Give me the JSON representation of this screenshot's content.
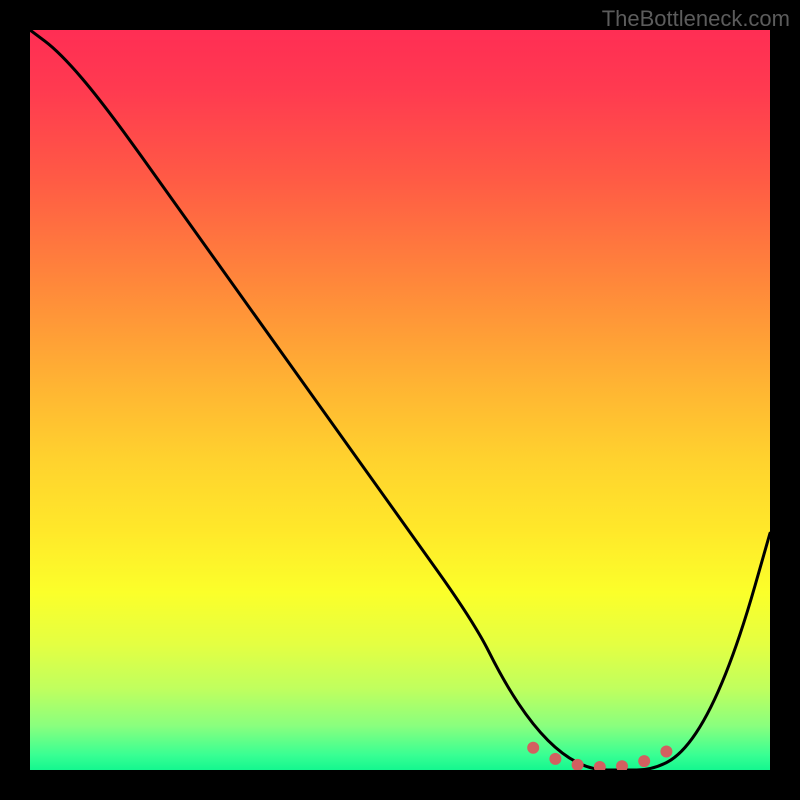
{
  "watermark": "TheBottleneck.com",
  "chart_data": {
    "type": "line",
    "title": "",
    "xlabel": "",
    "ylabel": "",
    "xlim": [
      0,
      100
    ],
    "ylim": [
      0,
      100
    ],
    "series": [
      {
        "name": "bottleneck-curve",
        "x": [
          0,
          4,
          10,
          20,
          30,
          40,
          50,
          60,
          64,
          68,
          72,
          76,
          80,
          84,
          88,
          92,
          96,
          100
        ],
        "values": [
          100,
          97,
          90,
          76,
          62,
          48,
          34,
          20,
          12,
          6,
          2,
          0,
          0,
          0,
          2,
          8,
          18,
          32
        ]
      }
    ],
    "markers": {
      "name": "optimal-range",
      "x": [
        68,
        71,
        74,
        77,
        80,
        83,
        86
      ],
      "values": [
        3,
        1.5,
        0.7,
        0.4,
        0.5,
        1.2,
        2.5
      ]
    },
    "gradient_stops": [
      {
        "pct": 0,
        "color": "#ff2e54"
      },
      {
        "pct": 20,
        "color": "#ff5a45"
      },
      {
        "pct": 48,
        "color": "#ffb433"
      },
      {
        "pct": 76,
        "color": "#fbff2a"
      },
      {
        "pct": 94,
        "color": "#8aff7e"
      },
      {
        "pct": 100,
        "color": "#14f78f"
      }
    ]
  }
}
